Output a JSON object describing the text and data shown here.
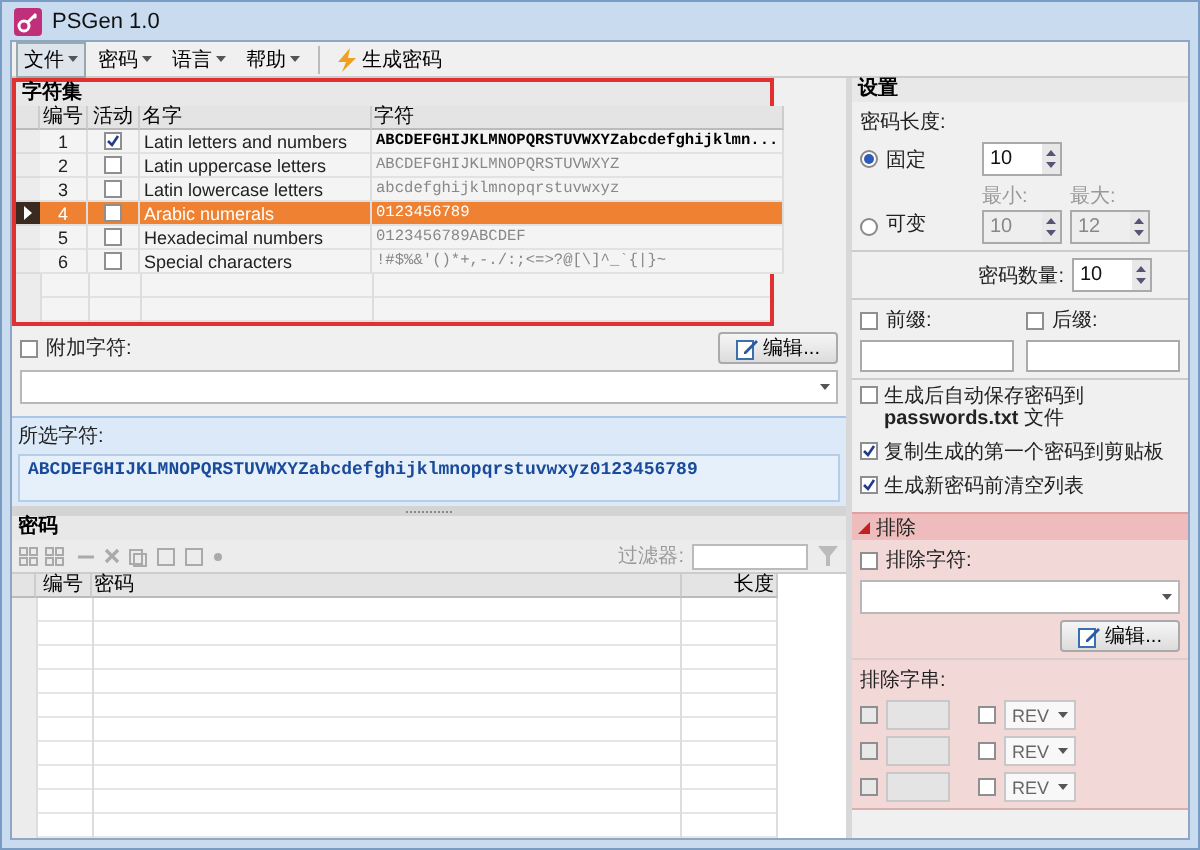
{
  "window": {
    "title": "PSGen 1.0"
  },
  "menu": [
    {
      "label": "文件",
      "selected": true
    },
    {
      "label": "密码",
      "selected": false
    },
    {
      "label": "语言",
      "selected": false
    },
    {
      "label": "帮助",
      "selected": false
    }
  ],
  "generate_button": {
    "label": "生成密码"
  },
  "charset": {
    "title": "字符集",
    "columns": [
      "编号",
      "活动",
      "名字",
      "字符"
    ],
    "rows": [
      {
        "number": "1",
        "active": true,
        "name": "Latin letters and numbers",
        "chars": "ABCDEFGHIJKLMNOPQRSTUVWXYZabcdefghijklmn...",
        "selected": false
      },
      {
        "number": "2",
        "active": false,
        "name": "Latin uppercase letters",
        "chars": "ABCDEFGHIJKLMNOPQRSTUVWXYZ",
        "selected": false
      },
      {
        "number": "3",
        "active": false,
        "name": "Latin lowercase letters",
        "chars": "abcdefghijklmnopqrstuvwxyz",
        "selected": false
      },
      {
        "number": "4",
        "active": false,
        "name": "Arabic numerals",
        "chars": "0123456789",
        "selected": true
      },
      {
        "number": "5",
        "active": false,
        "name": "Hexadecimal numbers",
        "chars": "0123456789ABCDEF",
        "selected": false
      },
      {
        "number": "6",
        "active": false,
        "name": "Special characters",
        "chars": "!#$%&'()*+,-./:;<=>?@[\\]^_`{|}~",
        "selected": false
      }
    ]
  },
  "additional": {
    "label": "附加字符:",
    "checked": false,
    "edit_button": "编辑..."
  },
  "selected_chars": {
    "label": "所选字符:",
    "value": "ABCDEFGHIJKLMNOPQRSTUVWXYZabcdefghijklmnopqrstuvwxyz0123456789"
  },
  "passwords": {
    "title": "密码",
    "filter_label": "过滤器:",
    "columns": [
      "编号",
      "密码",
      "长度"
    ]
  },
  "settings": {
    "title": "设置",
    "length_label": "密码长度:",
    "fixed": {
      "label": "固定",
      "selected": true,
      "value": "10"
    },
    "variable": {
      "label": "可变",
      "selected": false,
      "min_label": "最小:",
      "min": "10",
      "max_label": "最大:",
      "max": "12"
    },
    "count_label": "密码数量:",
    "count": "10",
    "prefix": {
      "label": "前缀:",
      "checked": false
    },
    "suffix": {
      "label": "后缀:",
      "checked": false
    },
    "options": [
      {
        "label": "生成后自动保存密码到 **passwords.txt** 文件",
        "checked": false
      },
      {
        "label": "复制生成的第一个密码到剪贴板",
        "checked": true
      },
      {
        "label": "生成新密码前清空列表",
        "checked": true
      }
    ]
  },
  "exclude": {
    "title": "排除",
    "expanded": true,
    "chars_label": "排除字符:",
    "chars_checked": false,
    "edit_button": "编辑...",
    "strings_label": "排除字串:",
    "strings": [
      {
        "checked": false,
        "rev_checked": false,
        "mode": "REV"
      },
      {
        "checked": false,
        "rev_checked": false,
        "mode": "REV"
      },
      {
        "checked": false,
        "rev_checked": false,
        "mode": "REV"
      }
    ]
  }
}
